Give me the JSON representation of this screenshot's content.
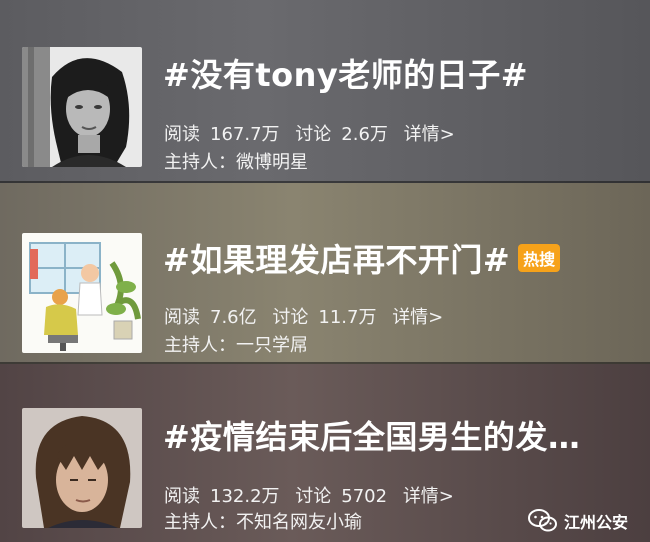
{
  "topics": [
    {
      "title": "#没有tony老师的日子#",
      "hot_badge": "",
      "read_label": "阅读",
      "read_count": "167.7万",
      "discuss_label": "讨论",
      "discuss_count": "2.6万",
      "details_label": "详情>",
      "host_label": "主持人：",
      "host_name": "微博明星"
    },
    {
      "title": "#如果理发店再不开门#",
      "hot_badge": "热搜",
      "read_label": "阅读",
      "read_count": "7.6亿",
      "discuss_label": "讨论",
      "discuss_count": "11.7万",
      "details_label": "详情>",
      "host_label": "主持人：",
      "host_name": "一只学屌"
    },
    {
      "title": "#疫情结束后全国男生的发…",
      "hot_badge": "",
      "read_label": "阅读",
      "read_count": "132.2万",
      "discuss_label": "讨论",
      "discuss_count": "5702",
      "details_label": "详情>",
      "host_label": "主持人：",
      "host_name": "不知名网友小瑜"
    }
  ],
  "watermark": {
    "text": "江州公安",
    "icon": "wechat-icon"
  },
  "colors": {
    "badge": "#f6a21a",
    "text": "#ffffff"
  }
}
